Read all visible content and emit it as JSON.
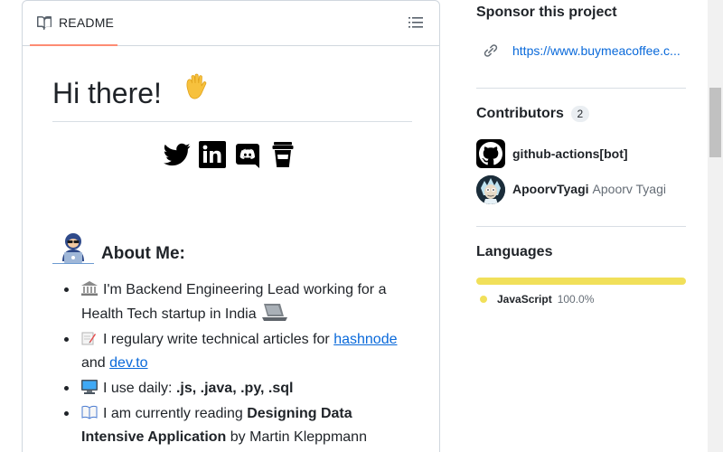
{
  "readme": {
    "tab_label": "README",
    "title": "Hi there!",
    "about_heading": "About Me:",
    "social_icons": [
      "twitter-icon",
      "linkedin-icon",
      "discord-icon",
      "buymeacoffee-icon"
    ],
    "items": [
      {
        "pre": "I'm Backend Engineering Lead working for a Health Tech startup in India"
      },
      {
        "pre": "I regulary write technical articles for ",
        "link1": "hashnode",
        "mid": "and ",
        "link2": "dev.to"
      },
      {
        "pre": "I use daily: ",
        "bold": ".js, .java, .py, .sql"
      },
      {
        "pre": "I am currently reading ",
        "bold": "Designing Data Intensive Application",
        "post": " by Martin Kleppmann"
      }
    ]
  },
  "sidebar": {
    "sponsor_title": "Sponsor this project",
    "sponsor_url": "https://www.buymeacoffee.c...",
    "contributors_title": "Contributors",
    "contributors_count": "2",
    "contributors": [
      {
        "login": "github-actions[bot]",
        "name": ""
      },
      {
        "login": "ApoorvTyagi",
        "name": "Apoorv Tyagi"
      }
    ],
    "languages_title": "Languages",
    "languages": [
      {
        "name": "JavaScript",
        "percent": "100.0%",
        "color": "#f1e05a",
        "fraction": 1.0
      }
    ]
  },
  "colors": {
    "link": "#0969da",
    "tab_underline": "#fd8c73",
    "border": "#d0d7de"
  }
}
